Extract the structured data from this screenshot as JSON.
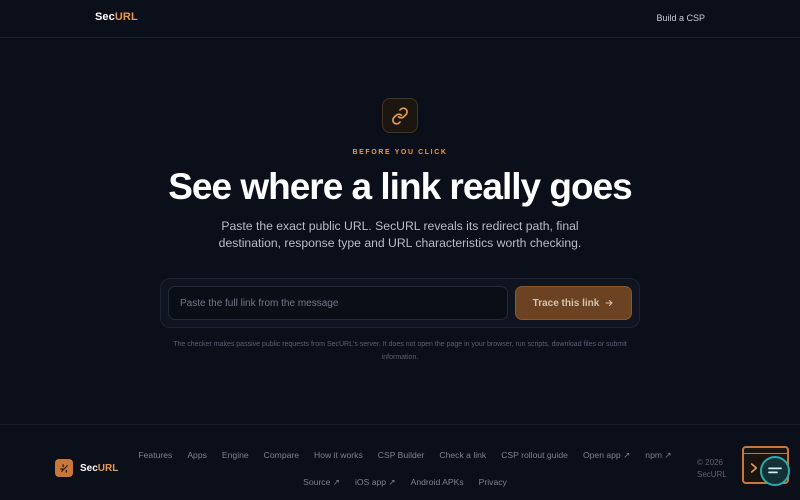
{
  "header": {
    "brand_prefix": "Sec",
    "brand_suffix": "URL",
    "nav_link": "Build a CSP"
  },
  "hero": {
    "icon": "link-icon",
    "eyebrow": "BEFORE YOU CLICK",
    "title": "See where a link really goes",
    "subtitle": "Paste the exact public URL. SecURL reveals its redirect path, final destination, response type and URL characteristics worth checking."
  },
  "form": {
    "input_value": "",
    "input_placeholder": "Paste the full link from the message",
    "button_label": "Trace this link",
    "button_icon": "arrow-right-icon",
    "disclaimer": "The checker makes passive public requests from SecURL's server. It does not open the page in your browser, run scripts, download files or submit information."
  },
  "footer": {
    "brand_prefix": "Sec",
    "brand_suffix": "URL",
    "links": [
      {
        "label": "Features"
      },
      {
        "label": "Apps"
      },
      {
        "label": "Engine"
      },
      {
        "label": "Compare"
      },
      {
        "label": "How it works"
      },
      {
        "label": "CSP Builder"
      },
      {
        "label": "Check a link"
      },
      {
        "label": "CSP rollout guide"
      },
      {
        "label": "Open app ↗"
      },
      {
        "label": "npm ↗"
      },
      {
        "label": "Source ↗"
      },
      {
        "label": "iOS app ↗"
      },
      {
        "label": "Android APKs"
      },
      {
        "label": "Privacy"
      }
    ],
    "copyright_line1": "© 2026",
    "copyright_line2": "SecURL"
  },
  "colors": {
    "background": "#0a0f1a",
    "accent": "#e89a52",
    "button": "#6b4322",
    "widget_ring": "#27aab0"
  }
}
